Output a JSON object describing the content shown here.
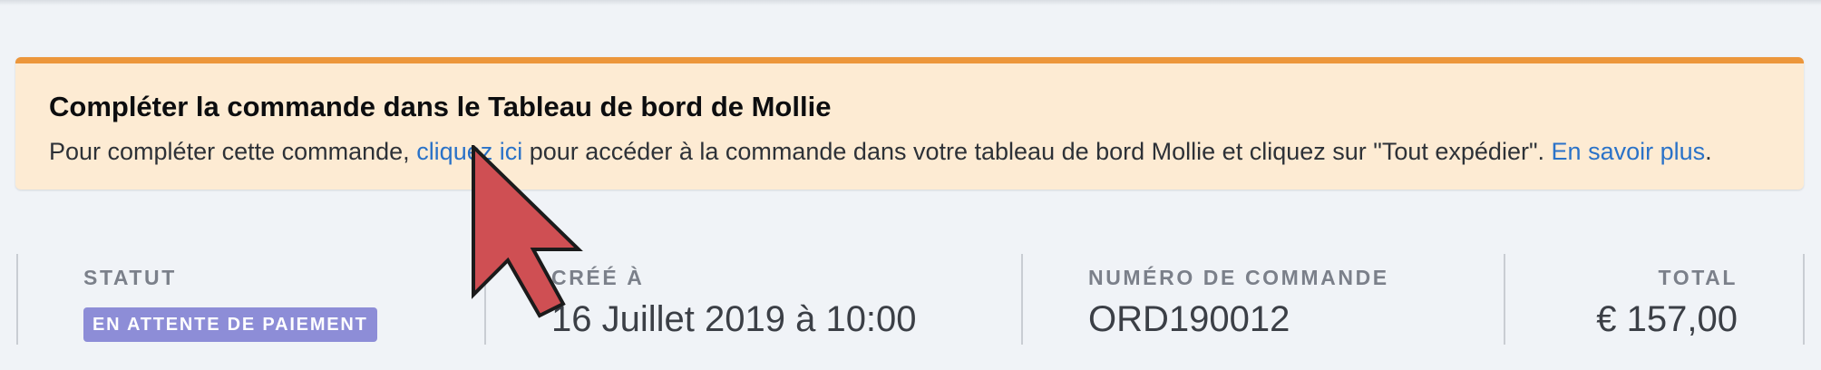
{
  "notice": {
    "title": "Compléter la commande dans le Tableau de bord de Mollie",
    "text_before": "Pour compléter cette commande, ",
    "link_here": "cliquez ici",
    "text_after": " pour accéder à la commande dans votre tableau de bord Mollie et cliquez sur \"Tout expédier\". ",
    "link_learn_more": "En savoir plus",
    "text_end": "."
  },
  "order": {
    "status_label": "STATUT",
    "status_badge": "EN ATTENTE DE PAIEMENT",
    "created_label": "CRÉÉ À",
    "created_value": "16 Juillet 2019 à 10:00",
    "number_label": "NUMÉRO DE COMMANDE",
    "number_value": "ORD190012",
    "total_label": "TOTAL",
    "total_value": "€ 157,00"
  },
  "colors": {
    "notice_bg": "#fdebd3",
    "notice_accent": "#ec963b",
    "link": "#2a72c8",
    "badge_bg": "#8d8dd7",
    "cursor_fill": "#cf4f53"
  },
  "icons": {
    "cursor": "mouse-pointer-icon"
  }
}
